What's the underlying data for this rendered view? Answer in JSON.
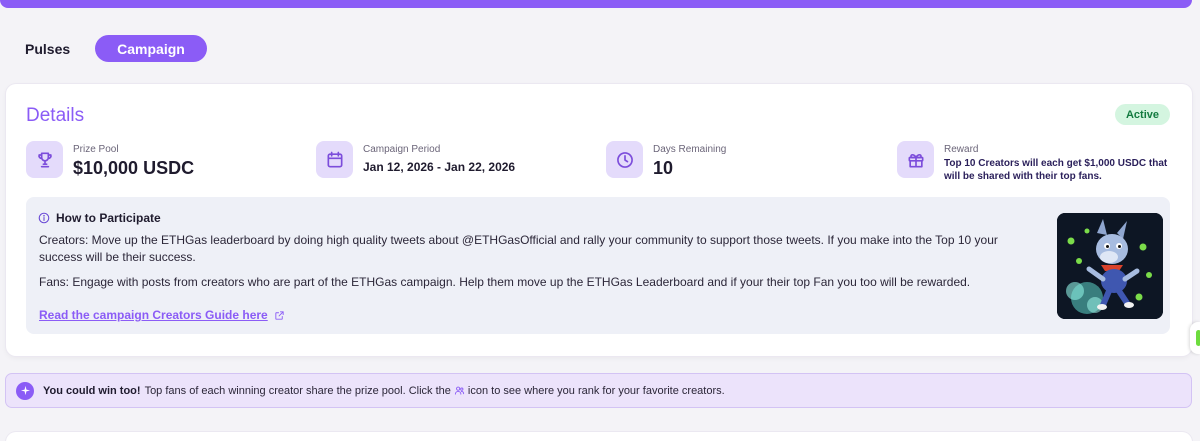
{
  "tabs": [
    {
      "label": "Pulses",
      "active": false
    },
    {
      "label": "Campaign",
      "active": true
    }
  ],
  "details": {
    "title": "Details",
    "status": "Active",
    "stats": {
      "prize_pool": {
        "label": "Prize Pool",
        "value": "$10,000 USDC",
        "icon": "trophy-icon"
      },
      "campaign_period": {
        "label": "Campaign Period",
        "value": "Jan 12, 2026 - Jan 22, 2026",
        "icon": "calendar-icon"
      },
      "days_remaining": {
        "label": "Days Remaining",
        "value": "10",
        "icon": "clock-icon"
      },
      "reward": {
        "label": "Reward",
        "value": "Top 10 Creators will each get $1,000 USDC that will be shared with their top fans.",
        "icon": "gift-icon"
      }
    },
    "how_to": {
      "title": "How to Participate",
      "creators_text": "Creators: Move up the ETHGas leaderboard by doing high quality tweets about @ETHGasOfficial and rally your community to support those tweets. If you make into the Top 10 your success will be their success.",
      "fans_text": "Fans: Engage with posts from creators who are part of the ETHGas campaign. Help them move up the ETHGas Leaderboard and if your their top Fan you too will be rewarded.",
      "guide_link": "Read the campaign Creators Guide here"
    }
  },
  "banner": {
    "bold": "You could win too!",
    "text_before_icon": "Top fans of each winning creator share the prize pool. Click the",
    "text_after_icon": "icon to see where you rank for your favorite creators."
  },
  "colors": {
    "accent": "#8b5cf6",
    "active_badge_bg": "#d4f5e0",
    "active_badge_text": "#137a3f",
    "icon_tile_bg": "#e4dbfb",
    "banner_bg": "#ece3fb"
  }
}
